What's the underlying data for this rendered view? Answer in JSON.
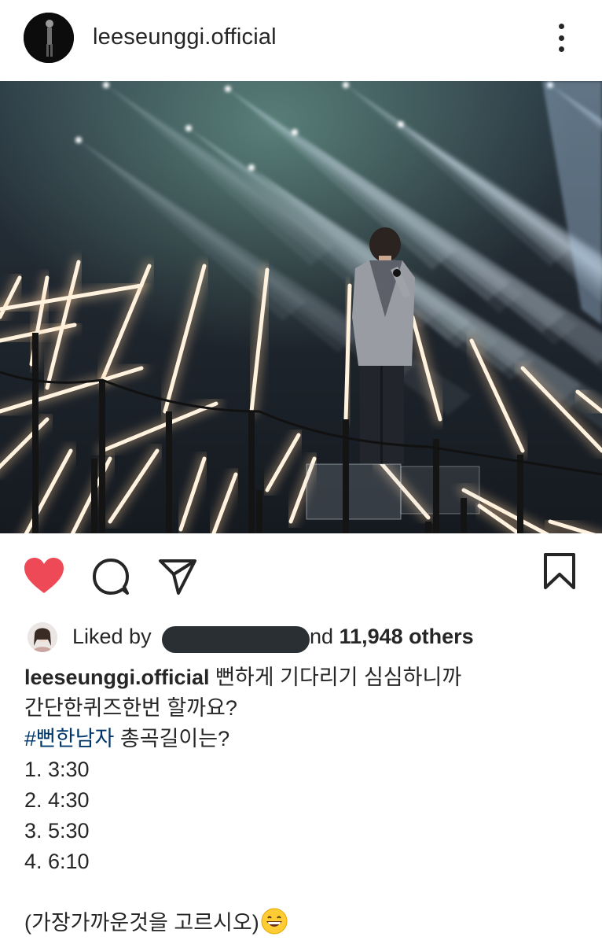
{
  "post": {
    "username": "leeseunggi.official",
    "more_icon": "more-vertical-icon"
  },
  "actions": {
    "like_icon": "heart-filled-icon",
    "comment_icon": "comment-icon",
    "share_icon": "send-icon",
    "save_icon": "bookmark-icon",
    "like_color": "#ed4956"
  },
  "likes": {
    "prefix": "Liked by",
    "suffix_partial": "nd",
    "count_text": "11,948 others"
  },
  "caption": {
    "username": "leeseunggi.official",
    "line1": "뻔하게 기다리기 심심하니까",
    "line2": "간단한퀴즈한번 할까요?",
    "hashtag": "#뻔한남자",
    "line3_rest": " 총곡길이는?",
    "options": [
      "1. 3:30",
      "2. 4:30",
      "3. 5:30",
      "4. 6:10"
    ],
    "closing": "(가장가까운것을 고르시오)",
    "closing_emoji": "grinning-face-emoji"
  }
}
